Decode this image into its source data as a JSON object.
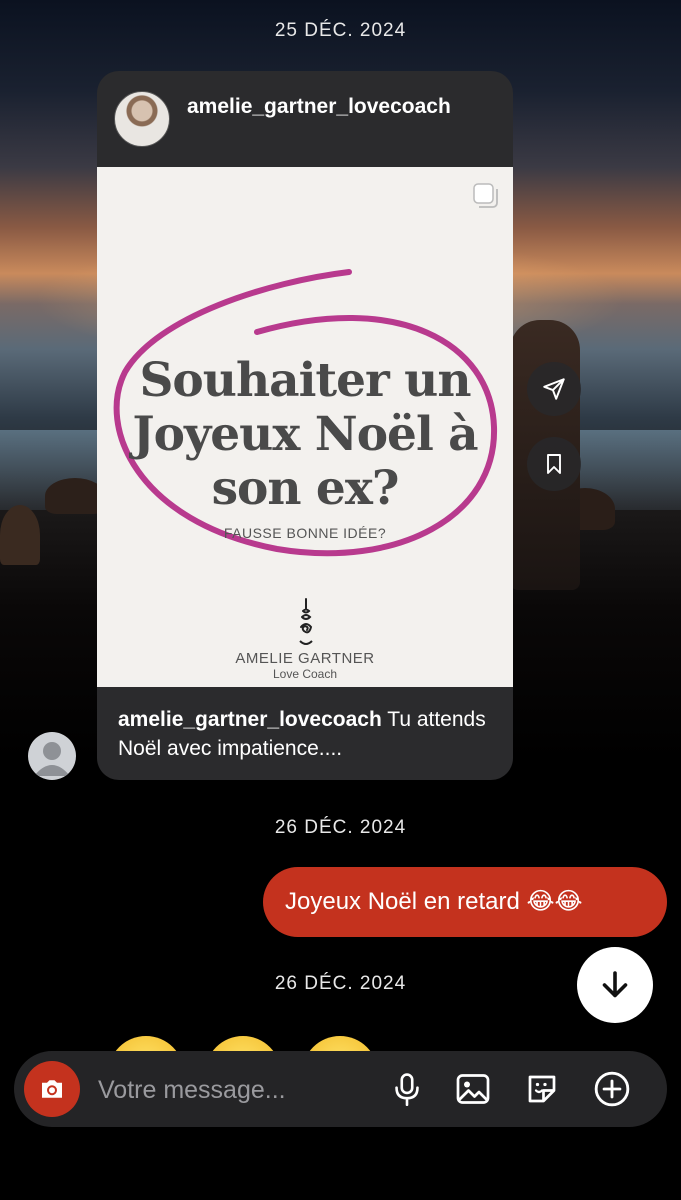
{
  "dates": {
    "first": "25 DÉC. 2024",
    "second": "26 DÉC. 2024",
    "third": "26 DÉC. 2024"
  },
  "shared_post": {
    "username": "amelie_gartner_lovecoach",
    "headline": [
      "Souhaiter un",
      "Joyeux Noël à",
      "son ex?"
    ],
    "subline": "FAUSSE BONNE IDÉE?",
    "brand_name": "AMELIE GARTNER",
    "brand_sub": "Love Coach",
    "caption_user": "amelie_gartner_lovecoach",
    "caption_text": " Tu attends Noël avec impatience....",
    "accent_color": "#b83a8e"
  },
  "outgoing_message": {
    "text": "Joyeux Noël en retard 😂😂",
    "bubble_color": "#c4321e"
  },
  "composer": {
    "placeholder": "Votre message...",
    "value": ""
  },
  "icons": {
    "share": "paper-plane-icon",
    "save": "bookmark-icon",
    "carousel": "carousel-icon",
    "scroll": "arrow-down-icon",
    "camera": "camera-icon",
    "mic": "microphone-icon",
    "gallery": "image-icon",
    "sticker": "sticker-icon",
    "more": "plus-circle-icon"
  }
}
